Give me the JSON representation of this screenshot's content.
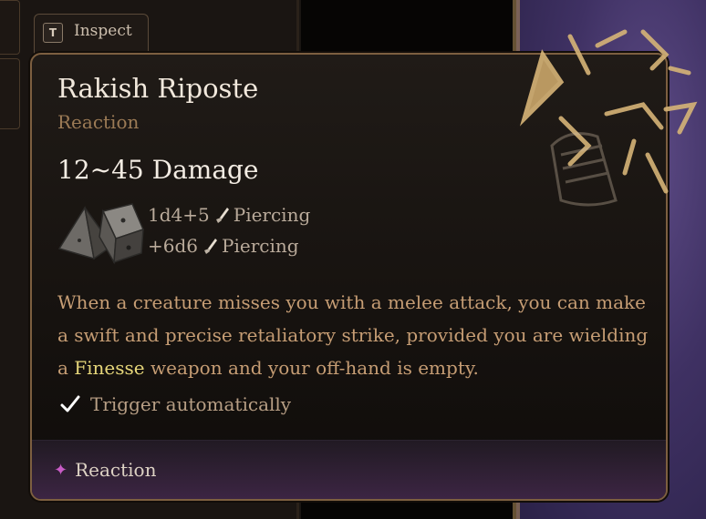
{
  "inspect": {
    "key": "T",
    "label": "Inspect"
  },
  "tooltip": {
    "title": "Rakish Riposte",
    "subtitle": "Reaction",
    "damage": "12~45 Damage",
    "damage_lines": [
      {
        "amount": "1d4+5",
        "type": "Piercing"
      },
      {
        "amount": "+6d6",
        "type": "Piercing"
      }
    ],
    "description": {
      "before": "When a creature misses you with a melee attack, you can make a swift and precise retaliatory strike, provided you are wielding a ",
      "highlight": "Finesse",
      "after": " weapon and your off-hand is empty."
    },
    "trigger": "Trigger automatically",
    "footer_label": "Reaction"
  },
  "icons": {
    "dice": "dice-icon",
    "piercing": "dagger-icon",
    "trigger": "checkmark-icon",
    "art": "riposte-art-icon"
  },
  "colors": {
    "border": "#7d5f40",
    "highlight": "#e6d67a",
    "footer_accent": "#c95cc7"
  }
}
